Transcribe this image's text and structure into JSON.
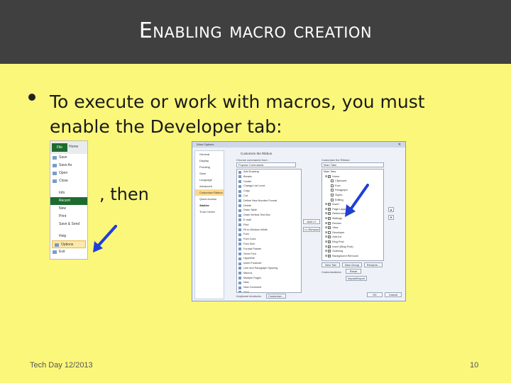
{
  "slide": {
    "title": "Enabling macro creation",
    "bullet": "To execute or work with macros, you must enable the Developer tab:",
    "then_text": ", then",
    "footer_left": "Tech Day 12/2013",
    "page_number": "10"
  },
  "backstage": {
    "file_tab": "File",
    "home_tab": "Home",
    "items": [
      {
        "label": "Save",
        "state": "normal"
      },
      {
        "label": "Save As",
        "state": "normal"
      },
      {
        "label": "Open",
        "state": "normal"
      },
      {
        "label": "Close",
        "state": "normal"
      },
      {
        "label": "Info",
        "state": "normal"
      },
      {
        "label": "Recent",
        "state": "selected"
      },
      {
        "label": "New",
        "state": "normal"
      },
      {
        "label": "Print",
        "state": "normal"
      },
      {
        "label": "Save & Send",
        "state": "normal"
      },
      {
        "label": "Help",
        "state": "normal"
      },
      {
        "label": "Options",
        "state": "highlighted"
      },
      {
        "label": "Exit",
        "state": "normal"
      }
    ]
  },
  "options_dialog": {
    "title": "Word Options",
    "nav": [
      "General",
      "Display",
      "Proofing",
      "Save",
      "Language",
      "Advanced",
      "Customize Ribbon",
      "Quick Access Toolbar",
      "Add-Ins",
      "Trust Center"
    ],
    "nav_selected": "Customize Ribbon",
    "heading": "Customize the Ribbon.",
    "choose_label": "Choose commands from:",
    "choose_value": "Popular Commands",
    "customize_label": "Customize the Ribbon:",
    "customize_value": "Main Tabs",
    "commands": [
      "Add Drawing",
      "Breaks",
      "Center",
      "Change List Level",
      "Copy",
      "Cut",
      "Define New Number Format",
      "Delete",
      "Draw Table",
      "Draw Vertical Text Box",
      "E-mail",
      "Find",
      "Fit to Window Width",
      "Font",
      "Font Color",
      "Font Size",
      "Format Painter",
      "Grow Font",
      "Hyperlink",
      "Insert Footnote",
      "Line and Paragraph Spacing",
      "Macros",
      "Multiple Pages",
      "New",
      "New Comment",
      "Next",
      "One Page",
      "Open",
      "Page Setup",
      "Paragraph"
    ],
    "tree_title": "Main Tabs",
    "tree": [
      {
        "label": "Home",
        "checked": true,
        "indent": 0
      },
      {
        "label": "Clipboard",
        "checked": false,
        "indent": 1
      },
      {
        "label": "Font",
        "checked": false,
        "indent": 1
      },
      {
        "label": "Paragraph",
        "checked": false,
        "indent": 1
      },
      {
        "label": "Styles",
        "checked": false,
        "indent": 1
      },
      {
        "label": "Editing",
        "checked": false,
        "indent": 1
      },
      {
        "label": "Insert",
        "checked": true,
        "indent": 0
      },
      {
        "label": "Page Layout",
        "checked": true,
        "indent": 0
      },
      {
        "label": "References",
        "checked": true,
        "indent": 0
      },
      {
        "label": "Mailings",
        "checked": true,
        "indent": 0
      },
      {
        "label": "Review",
        "checked": true,
        "indent": 0
      },
      {
        "label": "View",
        "checked": true,
        "indent": 0
      },
      {
        "label": "Developer",
        "checked": false,
        "indent": 0
      },
      {
        "label": "Add-Ins",
        "checked": true,
        "indent": 0
      },
      {
        "label": "Blog Post",
        "checked": true,
        "indent": 0
      },
      {
        "label": "Insert (Blog Post)",
        "checked": true,
        "indent": 0
      },
      {
        "label": "Outlining",
        "checked": true,
        "indent": 0
      },
      {
        "label": "Background Removal",
        "checked": true,
        "indent": 0
      }
    ],
    "add_button": "Add >>",
    "remove_button": "<< Remove",
    "new_tab_button": "New Tab",
    "new_group_button": "New Group",
    "rename_button": "Rename...",
    "customizations_label": "Customizations:",
    "reset_button": "Reset",
    "import_export_button": "Import/Export",
    "keyboard_label": "Keyboard shortcuts:",
    "customize_button": "Customize...",
    "ok_button": "OK",
    "cancel_button": "Cancel"
  },
  "colors": {
    "background": "#fbf77a",
    "title_bar": "#404040",
    "arrow_blue": "#1f3fd6",
    "file_green": "#1e6b2f"
  }
}
